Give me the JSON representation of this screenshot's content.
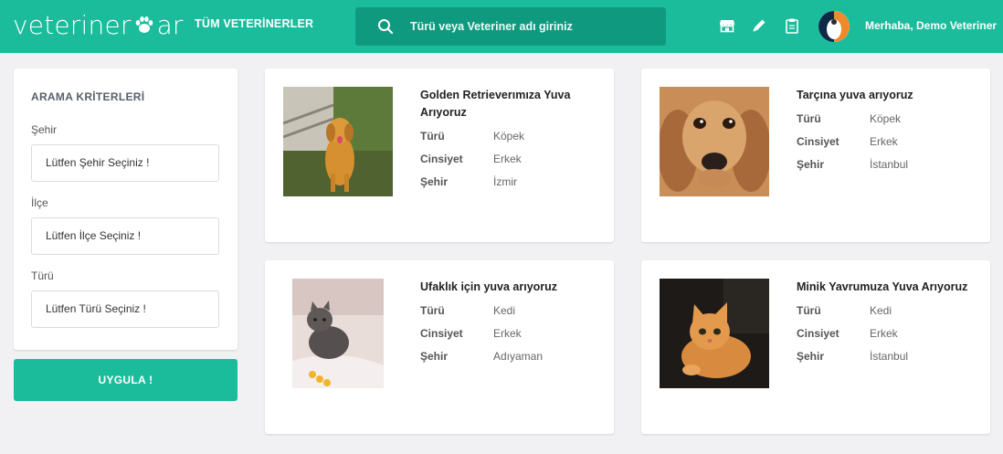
{
  "header": {
    "logo_left": "veteriner",
    "logo_right": "ar",
    "nav_all": "TÜM VETERİNERLER",
    "search_placeholder": "Türü veya Veteriner adı giriniz",
    "greeting": "Merhaba, Demo Veteriner",
    "accent": "#1abc9c",
    "icons": [
      "search-icon",
      "store-icon",
      "pencil-icon",
      "clipboard-icon"
    ]
  },
  "filters": {
    "title": "ARAMA KRİTERLERİ",
    "city_label": "Şehir",
    "city_value": "Lütfen Şehir Seçiniz !",
    "district_label": "İlçe",
    "district_value": "Lütfen İlçe Seçiniz !",
    "type_label": "Türü",
    "type_value": "Lütfen Türü Seçiniz !",
    "apply": "UYGULA !"
  },
  "labels": {
    "type": "Türü",
    "gender": "Cinsiyet",
    "city": "Şehir"
  },
  "listings": [
    {
      "title": "Golden Retrieverımıza Yuva Arıyoruz",
      "type": "Köpek",
      "gender": "Erkek",
      "city": "İzmir"
    },
    {
      "title": "Tarçına yuva arıyoruz",
      "type": "Köpek",
      "gender": "Erkek",
      "city": "İstanbul"
    },
    {
      "title": "Ufaklık için yuva arıyoruz",
      "type": "Kedi",
      "gender": "Erkek",
      "city": "Adıyaman"
    },
    {
      "title": "Minik Yavrumuza Yuva Arıyoruz",
      "type": "Kedi",
      "gender": "Erkek",
      "city": "İstanbul"
    }
  ]
}
